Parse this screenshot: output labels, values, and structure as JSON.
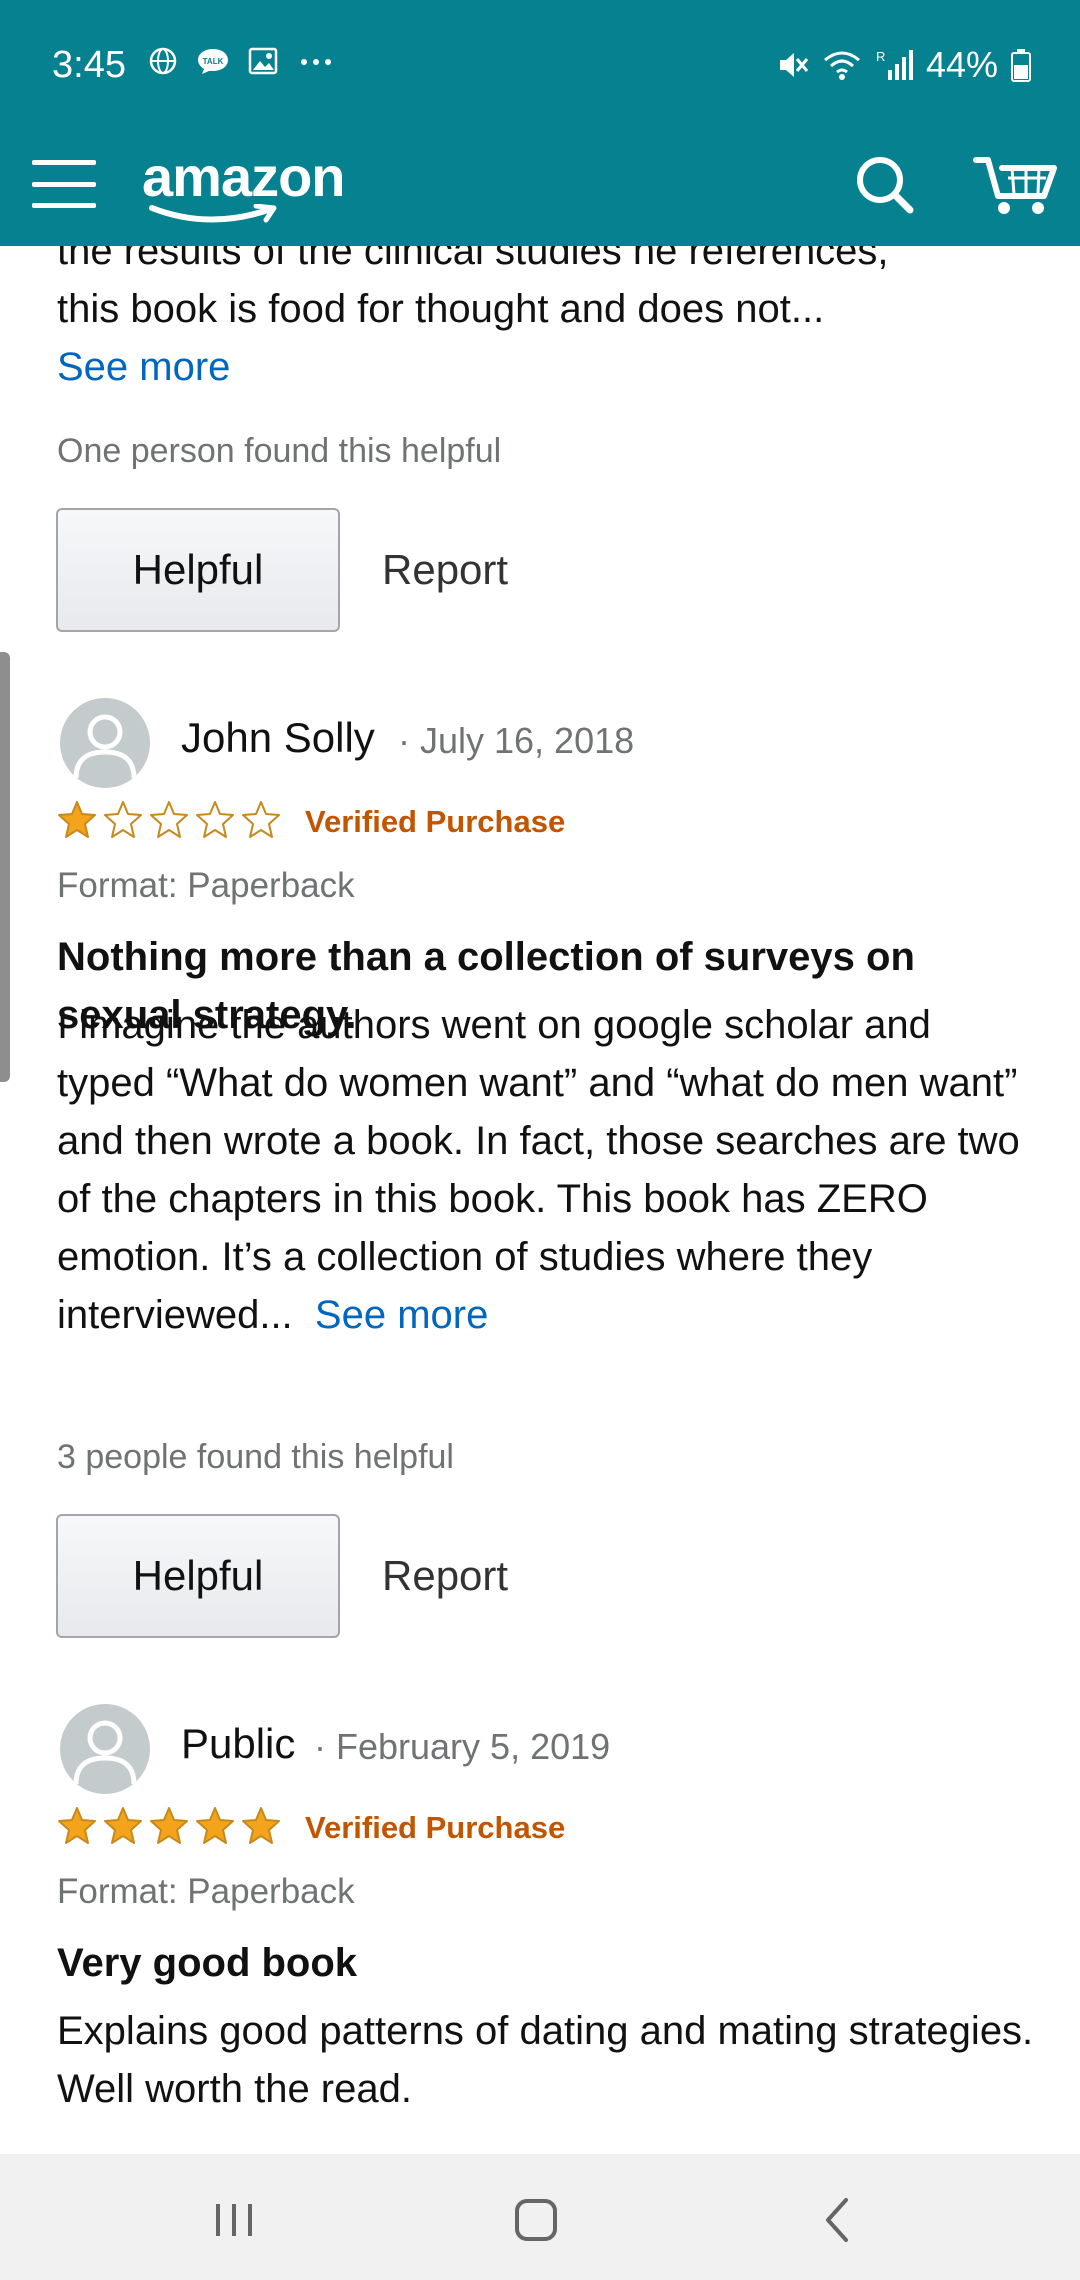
{
  "status_bar": {
    "time": "3:45",
    "battery": "44%",
    "icons": [
      "globe-icon",
      "talk-icon",
      "image-icon",
      "more-dots-icon",
      "mute-icon",
      "wifi-icon",
      "signal-icon",
      "battery-icon"
    ]
  },
  "header": {
    "logo_text": "amazon",
    "icons": [
      "menu-icon",
      "search-icon",
      "cart-icon"
    ],
    "color": "#06818f"
  },
  "colors": {
    "link": "#0066c0",
    "verified": "#c45500",
    "star": "#f4a41c"
  },
  "reviews": [
    {
      "body_line1": "the results of the clinical studies he references,",
      "body_line2": "this book is food for thought and does not...",
      "see_more": "See more",
      "helpful_count": "One person found this helpful",
      "helpful_label": "Helpful",
      "report_label": "Report"
    },
    {
      "reviewer": "John Solly",
      "date": "· July 16, 2018",
      "rating": 1,
      "verified": "Verified Purchase",
      "format": "Format: Paperback",
      "title": "Nothing more than a collection of surveys on sexual strategy.",
      "body": "I imagine the authors went on google scholar and typed “What do women want” and “what do men want” and then wrote a book. In fact, those searches are two of the chapters in this book. This book has ZERO emotion. It’s a collection of studies where they interviewed...",
      "see_more": "See more",
      "helpful_count": "3 people found this helpful",
      "helpful_label": "Helpful",
      "report_label": "Report"
    },
    {
      "reviewer": "Public",
      "date": "· February 5, 2019",
      "rating": 5,
      "verified": "Verified Purchase",
      "format": "Format: Paperback",
      "title": "Very good book",
      "body": "Explains good patterns of dating and mating strategies. Well worth the read."
    }
  ],
  "nav_bar": {
    "icons": [
      "recent-apps-icon",
      "home-icon",
      "back-icon"
    ]
  }
}
